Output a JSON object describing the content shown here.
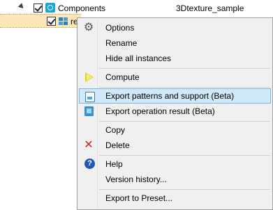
{
  "tree": {
    "components_label": "Components",
    "components_value": "3Dtexture_sample",
    "child_label": "re"
  },
  "menu": {
    "items": [
      {
        "label": "Options",
        "icon": "gear-icon"
      },
      {
        "label": "Rename"
      },
      {
        "label": "Hide all instances"
      },
      {
        "label": "Compute",
        "icon": "compute-play-icon"
      },
      {
        "label": "Export patterns and support  (Beta)",
        "icon": "export-patterns-icon"
      },
      {
        "label": "Export operation result (Beta)",
        "icon": "export-operation-icon"
      },
      {
        "label": "Copy"
      },
      {
        "label": "Delete",
        "icon": "delete-icon"
      },
      {
        "label": "Help",
        "icon": "help-icon",
        "glyph": "?"
      },
      {
        "label": "Version history..."
      },
      {
        "label": "Export to Preset..."
      }
    ],
    "highlighted_index": 4,
    "colors": {
      "highlight_bg": "#d1e8f8",
      "highlight_border": "#7ab6e0",
      "selected_row": "#fde7b9"
    }
  }
}
